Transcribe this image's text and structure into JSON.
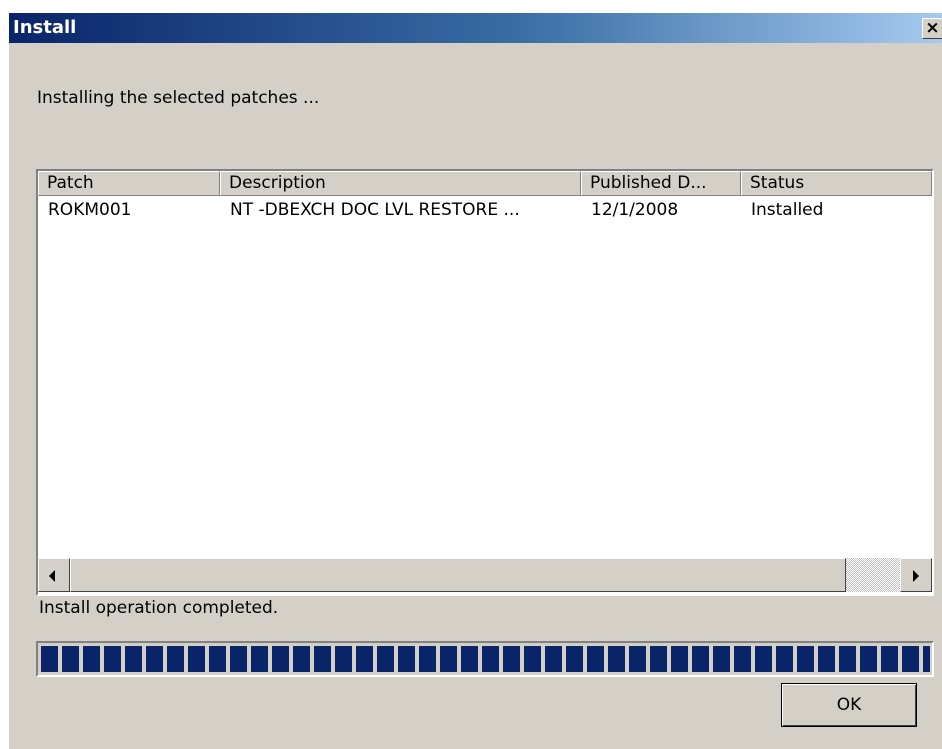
{
  "window": {
    "title": "Install",
    "close_glyph": "×"
  },
  "heading": "Installing the selected patches ...",
  "list": {
    "columns": [
      "Patch",
      "Description",
      "Published D...",
      "Status"
    ],
    "rows": [
      {
        "patch": "ROKM001",
        "description": "NT -DBEXCH DOC LVL RESTORE ...",
        "published": "12/1/2008",
        "status": "Installed"
      }
    ]
  },
  "status_text": "Install operation completed.",
  "progress": {
    "value": 1.0,
    "color": "#0a246a"
  },
  "buttons": {
    "ok_label": "OK"
  },
  "icons": {
    "close": "close-icon",
    "scroll_left": "scroll-left-arrow-icon",
    "scroll_right": "scroll-right-arrow-icon"
  }
}
